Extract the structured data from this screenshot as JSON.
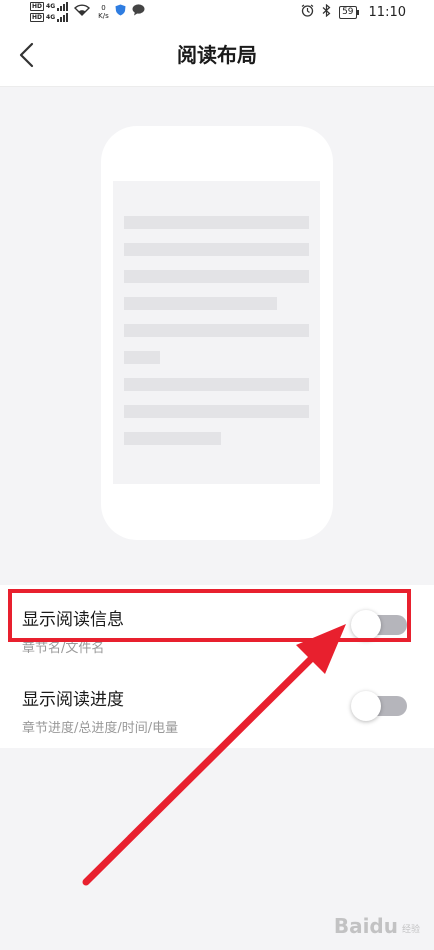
{
  "status_bar": {
    "sim1": {
      "hd": "HD",
      "network": "4G"
    },
    "sim2": {
      "hd": "HD",
      "network": "4G"
    },
    "speed_value": "0",
    "speed_unit": "K/s",
    "battery": "59",
    "time": "11:10",
    "icons": [
      "wifi-icon",
      "shield-icon",
      "chat-bubble-icon",
      "alarm-icon",
      "bluetooth-icon"
    ]
  },
  "header": {
    "title": "阅读布局",
    "back_icon": "chevron-left-icon"
  },
  "settings": [
    {
      "title": "显示阅读信息",
      "subtitle": "章节名/文件名",
      "enabled": false
    },
    {
      "title": "显示阅读进度",
      "subtitle": "章节进度/总进度/时间/电量",
      "enabled": false
    }
  ],
  "colors": {
    "annotation": "#e8202e",
    "toggle_off": "#b5b5bb",
    "background": "#f4f4f6"
  },
  "watermark": {
    "logo": "Baidu",
    "sub": "经验"
  }
}
